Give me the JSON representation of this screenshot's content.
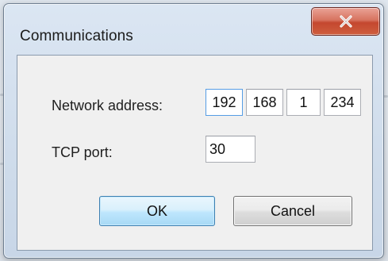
{
  "dialog": {
    "title": "Communications",
    "close_icon": "close-x-icon"
  },
  "form": {
    "network_address_label": "Network address:",
    "ip_octets": [
      "192",
      "168",
      "1",
      "234"
    ],
    "tcp_port_label": "TCP port:",
    "tcp_port_value": "30"
  },
  "buttons": {
    "ok_label": "OK",
    "cancel_label": "Cancel"
  },
  "colors": {
    "close_button": "#c4472f",
    "default_button_border": "#3c7fb1",
    "focus_border": "#569de5"
  }
}
